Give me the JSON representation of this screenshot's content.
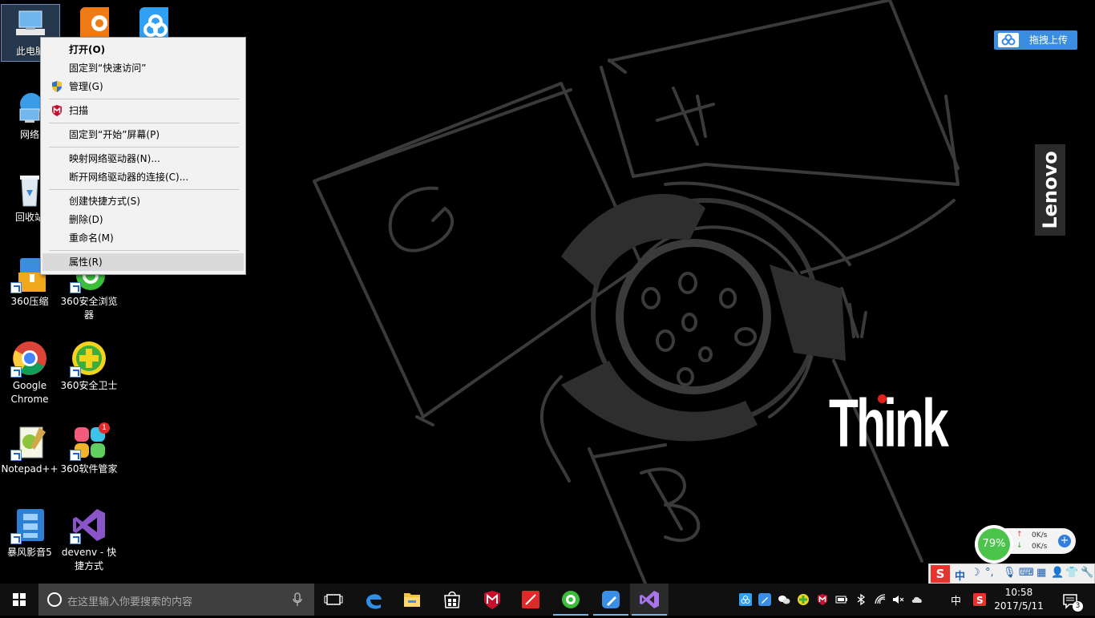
{
  "desktop": {
    "icons": [
      {
        "label": "此电脑"
      },
      {
        "label": "网络"
      },
      {
        "label": "回收站"
      },
      {
        "label": "360压缩"
      },
      {
        "label": "360安全浏览器"
      },
      {
        "label": "Google Chrome"
      },
      {
        "label": "360安全卫士"
      },
      {
        "label": "Notepad++"
      },
      {
        "label": "360软件管家"
      },
      {
        "label": "暴风影音5"
      },
      {
        "label": "devenv - 快捷方式"
      }
    ],
    "badge_count": "1"
  },
  "context_menu": {
    "items": [
      {
        "label": "打开(O)"
      },
      {
        "label": "固定到“快速访问”"
      },
      {
        "label": "管理(G)"
      },
      {
        "label": "扫描"
      },
      {
        "label": "固定到“开始”屏幕(P)"
      },
      {
        "label": "映射网络驱动器(N)..."
      },
      {
        "label": "断开网络驱动器的连接(C)..."
      },
      {
        "label": "创建快捷方式(S)"
      },
      {
        "label": "删除(D)"
      },
      {
        "label": "重命名(M)"
      },
      {
        "label": "属性(R)"
      }
    ]
  },
  "widgets": {
    "upload_label": "拖拽上传",
    "lenovo": "Lenovo",
    "think": "Think",
    "speed_percent": "79%",
    "upload_speed": "0K/s",
    "download_speed": "0K/s"
  },
  "taskbar": {
    "search_placeholder": "在这里输入你要搜索的内容",
    "ime_lang": "中",
    "time": "10:58",
    "date": "2017/5/11",
    "notification_count": "3",
    "ime_bar_lang": "中"
  },
  "colors": {
    "taskbar": "#101010",
    "accent": "#76b9ed",
    "think_dot": "#e2231a",
    "upload_btn": "#3b8de0"
  }
}
